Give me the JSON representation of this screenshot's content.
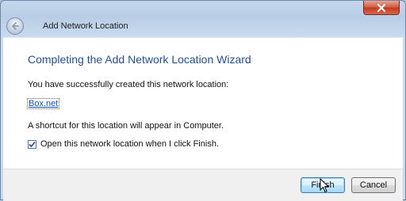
{
  "window": {
    "title": "Add Network Location",
    "close_icon": "close-icon"
  },
  "wizard": {
    "heading": "Completing the Add Network Location Wizard",
    "success_text": "You have successfully created this network location:",
    "location_link": "Box.net",
    "shortcut_text": "A shortcut for this location will appear in Computer.",
    "open_checkbox_label": "Open this network location when I click Finish.",
    "open_checkbox_checked": true
  },
  "buttons": {
    "finish": "Finish",
    "cancel": "Cancel"
  },
  "colors": {
    "heading": "#1f4f9c",
    "link": "#0a57b8",
    "close_button": "#c2391d"
  }
}
